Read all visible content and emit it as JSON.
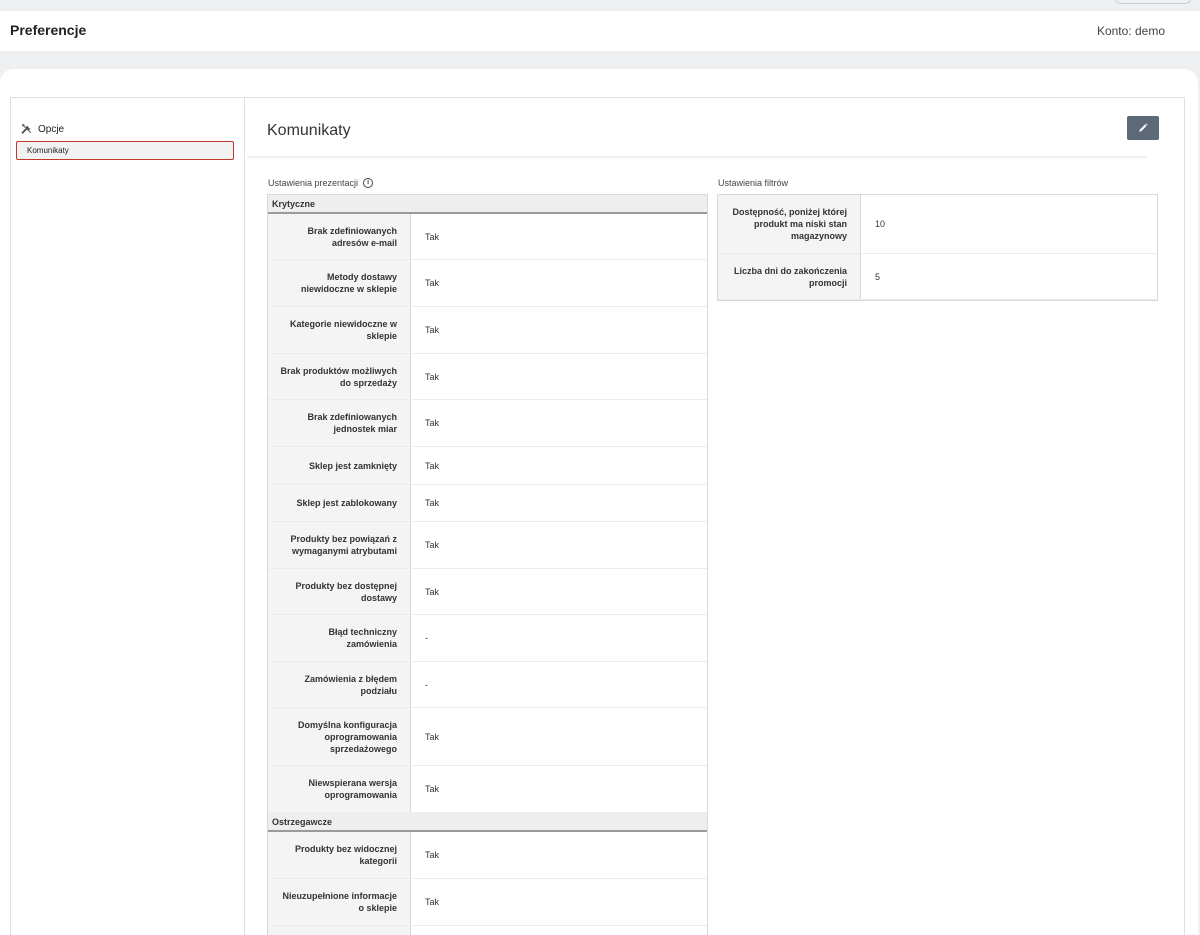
{
  "header": {
    "title": "Preferencje",
    "account": "Konto: demo"
  },
  "sidebar": {
    "heading": "Opcje",
    "heading_icon": "tools-icon",
    "items": [
      {
        "label": "Komunikaty",
        "active": true
      }
    ]
  },
  "main": {
    "title": "Komunikaty",
    "edit_icon": "pencil-icon"
  },
  "presentation": {
    "label": "Ustawienia prezentacji",
    "info_icon": "info-icon",
    "groups": [
      {
        "name": "Krytyczne",
        "rows": [
          {
            "label": "Brak zdefiniowanych adresów e-mail",
            "value": "Tak"
          },
          {
            "label": "Metody dostawy niewidoczne w sklepie",
            "value": "Tak"
          },
          {
            "label": "Kategorie niewidoczne w sklepie",
            "value": "Tak"
          },
          {
            "label": "Brak produktów możliwych do sprzedaży",
            "value": "Tak"
          },
          {
            "label": "Brak zdefiniowanych jednostek miar",
            "value": "Tak"
          },
          {
            "label": "Sklep jest zamknięty",
            "value": "Tak"
          },
          {
            "label": "Sklep jest zablokowany",
            "value": "Tak"
          },
          {
            "label": "Produkty bez powiązań z wymaganymi atrybutami",
            "value": "Tak"
          },
          {
            "label": "Produkty bez dostępnej dostawy",
            "value": "Tak"
          },
          {
            "label": "Błąd techniczny zamówienia",
            "value": "-"
          },
          {
            "label": "Zamówienia z błędem podziału",
            "value": "-"
          },
          {
            "label": "Domyślna konfiguracja oprogramowania sprzedażowego",
            "value": "Tak"
          },
          {
            "label": "Niewspierana wersja oprogramowania",
            "value": "Tak"
          }
        ]
      },
      {
        "name": "Ostrzegawcze",
        "rows": [
          {
            "label": "Produkty bez widocznej kategorii",
            "value": "Tak"
          },
          {
            "label": "Nieuzupełnione informacje o sklepie",
            "value": "Tak"
          },
          {
            "label": "",
            "value": ""
          }
        ]
      }
    ]
  },
  "filters": {
    "label": "Ustawienia filtrów",
    "rows": [
      {
        "label": "Dostępność, poniżej której produkt ma niski stan magazynowy",
        "value": "10"
      },
      {
        "label": "Liczba dni do zakończenia promocji",
        "value": "5"
      }
    ]
  }
}
